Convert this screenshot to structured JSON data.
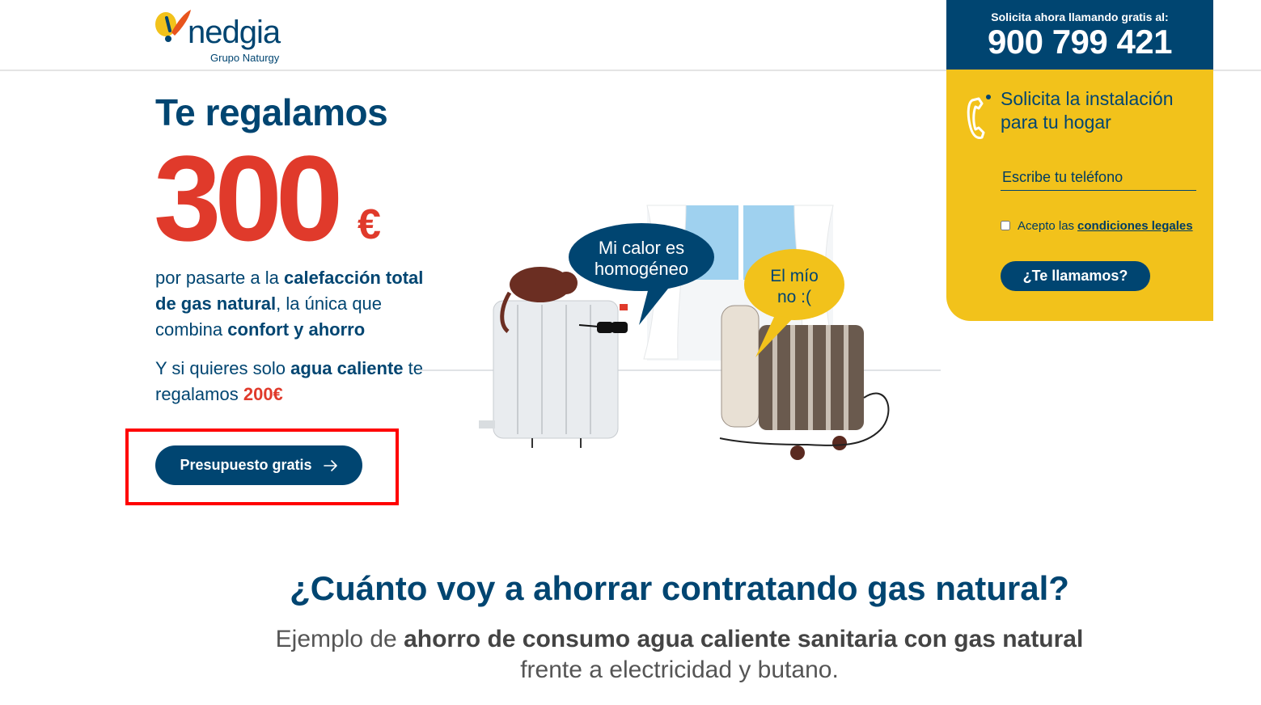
{
  "header": {
    "logo_text": "nedgia",
    "logo_subtitle": "Grupo Naturgy"
  },
  "call_panel": {
    "label": "Solicita ahora llamando gratis al:",
    "phone_number": "900 799 421"
  },
  "form": {
    "title_line1": "Solicita la instalación",
    "title_line2": "para tu hogar",
    "phone_placeholder": "Escribe tu teléfono",
    "accept_text": "Acepto las",
    "accept_link": "condiciones legales",
    "submit_label": "¿Te llamamos?"
  },
  "hero": {
    "title": "Te regalamos",
    "amount": "300",
    "currency": "€",
    "desc_part1": "por pasarte a la ",
    "desc_bold1": "calefacción total de gas natural",
    "desc_part2": ", la única que combina ",
    "desc_bold2": "confort y ahorro",
    "desc2_part1": "Y si quieres solo ",
    "desc2_bold": "agua caliente",
    "desc2_part2": " te regalamos ",
    "desc2_amount": "200€",
    "cta_label": "Presupuesto gratis",
    "bubble1_line1": "Mi calor es",
    "bubble1_line2": "homogéneo",
    "bubble2_line1": "El mío",
    "bubble2_line2": "no :("
  },
  "savings": {
    "title": "¿Cuánto voy a ahorrar contratando gas natural?",
    "subtitle_part1": "Ejemplo de ",
    "subtitle_bold": "ahorro de consumo agua caliente sanitaria con gas natural",
    "subtitle_part2": "frente a electricidad y butano."
  },
  "colors": {
    "primary": "#004571",
    "accent_red": "#e03a2b",
    "yellow": "#f2c21b"
  }
}
